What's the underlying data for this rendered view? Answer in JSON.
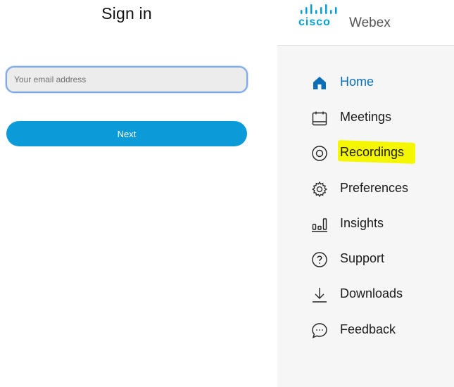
{
  "signin": {
    "title": "Sign in",
    "email_placeholder": "Your email address",
    "email_value": "",
    "next_label": "Next"
  },
  "brand": {
    "company_word": "cisco",
    "product": "Webex",
    "accent_color": "#049fd9"
  },
  "nav": {
    "items": [
      {
        "label": "Home",
        "icon": "home-icon",
        "active": true
      },
      {
        "label": "Meetings",
        "icon": "calendar-icon",
        "active": false
      },
      {
        "label": "Recordings",
        "icon": "recordings-icon",
        "active": false,
        "highlighted": true
      },
      {
        "label": "Preferences",
        "icon": "gear-icon",
        "active": false
      },
      {
        "label": "Insights",
        "icon": "insights-icon",
        "active": false
      },
      {
        "label": "Support",
        "icon": "help-icon",
        "active": false
      },
      {
        "label": "Downloads",
        "icon": "download-icon",
        "active": false
      },
      {
        "label": "Feedback",
        "icon": "feedback-icon",
        "active": false
      }
    ],
    "highlight_color": "#f4f700",
    "active_color": "#0a6fb7"
  }
}
